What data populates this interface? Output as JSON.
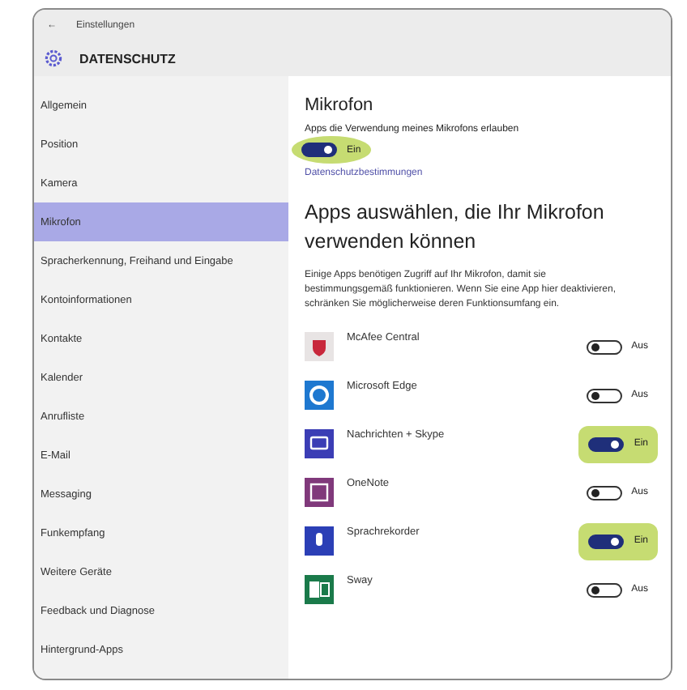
{
  "window": {
    "title": "Einstellungen",
    "back": "←"
  },
  "header": {
    "title": "DATENSCHUTZ"
  },
  "sidebar": {
    "items": [
      {
        "label": "Allgemein",
        "selected": false
      },
      {
        "label": "Position",
        "selected": false
      },
      {
        "label": "Kamera",
        "selected": false
      },
      {
        "label": "Mikrofon",
        "selected": true
      },
      {
        "label": "Spracherkennung, Freihand und Eingabe",
        "selected": false
      },
      {
        "label": "Kontoinformationen",
        "selected": false
      },
      {
        "label": "Kontakte",
        "selected": false
      },
      {
        "label": "Kalender",
        "selected": false
      },
      {
        "label": "Anrufliste",
        "selected": false
      },
      {
        "label": "E-Mail",
        "selected": false
      },
      {
        "label": "Messaging",
        "selected": false
      },
      {
        "label": "Funkempfang",
        "selected": false
      },
      {
        "label": "Weitere Geräte",
        "selected": false
      },
      {
        "label": "Feedback und Diagnose",
        "selected": false
      },
      {
        "label": "Hintergrund-Apps",
        "selected": false
      }
    ]
  },
  "content": {
    "title": "Mikrofon",
    "master": {
      "label": "Apps die Verwendung meines Mikrofons erlauben",
      "on": true,
      "state": "Ein",
      "highlighted": true
    },
    "link": "Datenschutzbestimmungen",
    "section_title": "Apps auswählen, die Ihr Mikrofon verwenden können",
    "description": "Einige Apps benötigen Zugriff auf Ihr Mikrofon, damit sie bestimmungsgemäß funktionieren. Wenn Sie eine App hier deaktivieren, schränken Sie möglicherweise deren Funktionsumfang ein.",
    "apps": [
      {
        "name": "McAfee Central",
        "kind": "shield",
        "color": "#e8e4e4",
        "on": false,
        "state": "Aus",
        "highlighted": false
      },
      {
        "name": "Microsoft Edge",
        "kind": "browser",
        "color": "#1e78d0",
        "on": false,
        "state": "Aus",
        "highlighted": false
      },
      {
        "name": "Nachrichten + Skype",
        "kind": "chat",
        "color": "#3b3db5",
        "on": true,
        "state": "Ein",
        "highlighted": true
      },
      {
        "name": "OneNote",
        "kind": "notebook",
        "color": "#80397b",
        "on": false,
        "state": "Aus",
        "highlighted": false
      },
      {
        "name": "Sprachrekorder",
        "kind": "microphone",
        "color": "#2b3fb6",
        "on": true,
        "state": "Ein",
        "highlighted": true
      },
      {
        "name": "Sway",
        "kind": "slides",
        "color": "#1a7a4a",
        "on": false,
        "state": "Aus",
        "highlighted": false
      }
    ]
  }
}
